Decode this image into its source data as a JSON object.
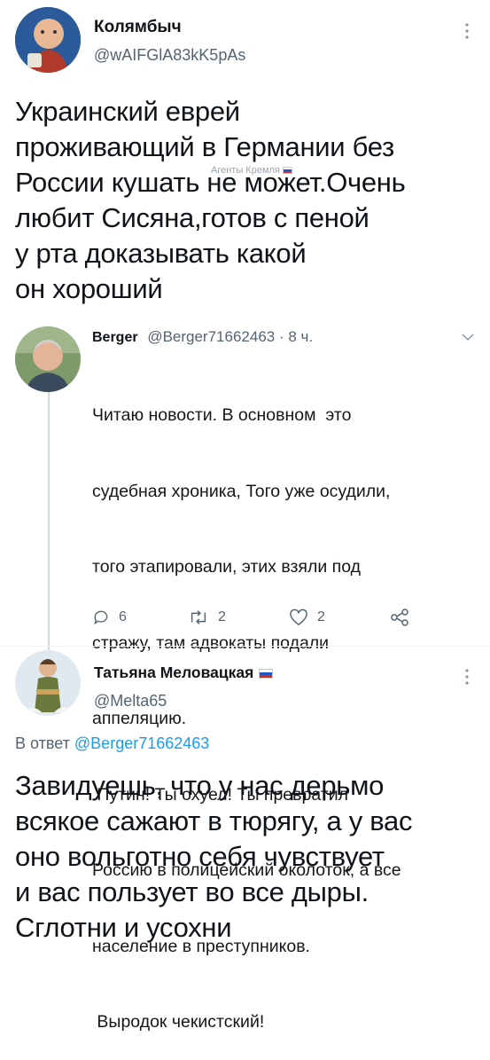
{
  "tweet1": {
    "author_name": "Колямбыч",
    "handle": "@wAIFGlA83kK5pAs",
    "body": [
      "Украинский еврей",
      "проживающий в Германии без",
      "России кушать не может.Очень",
      "любит Сисяна,готов с пеной",
      "у рта доказывать какой",
      "он хороший"
    ],
    "watermark": "Агенты Кремля"
  },
  "quoted": {
    "author_name": "Berger",
    "handle": "@Berger71662463",
    "time": "· 8 ч.",
    "lines": [
      "Читаю новости. В основном  это",
      "судебная хроника, Того уже осудили,",
      "того этапировали, этих взяли под",
      "стражу, там адвокаты подали",
      "аппеляцию.",
      " Путин! Ты охуел! Ты превратил",
      "Россию в полицейский околоток, а все",
      "население в преступников.",
      " Выродок чекистский!"
    ],
    "actions": {
      "replies": "6",
      "retweets": "2",
      "likes": "2"
    }
  },
  "tweet2": {
    "author_name": "Татьяна Меловацкая",
    "handle": "@Melta65",
    "reply_prefix": "В ответ",
    "reply_to": "@Berger71662463",
    "body": [
      "Завидуешь, что у нас дерьмо",
      "всякое сажают в тюрягу, а у вас",
      "оно вольготно себя чувствует",
      "и вас пользует во все дыры.",
      "Сглотни и усохни"
    ]
  },
  "colors": {
    "link": "#1d9bf0",
    "muted": "#536471",
    "thread_line": "#cfd9de"
  },
  "icons": [
    "reply-icon",
    "retweet-icon",
    "like-icon",
    "share-icon",
    "more-icon",
    "chevron-down-icon"
  ]
}
